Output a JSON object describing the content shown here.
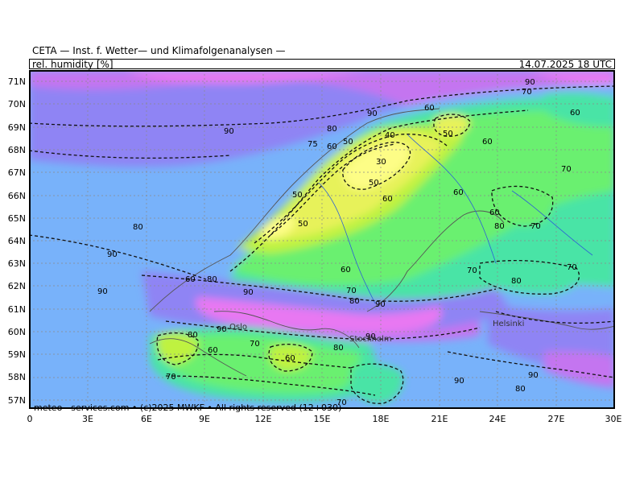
{
  "header": {
    "title": "CETA — Inst. f. Wetter— und Klimafolgenanalysen —",
    "variable": "rel. humidity [%]",
    "datetime": "14.07.2025 18 UTC"
  },
  "footer": "meteo—services.com • (c)2025 MWKF • All rights reserved (12+030)",
  "map": {
    "lat_labels": [
      "71N",
      "70N",
      "69N",
      "68N",
      "67N",
      "66N",
      "65N",
      "64N",
      "63N",
      "62N",
      "61N",
      "60N",
      "59N",
      "58N",
      "57N"
    ],
    "lon_labels": [
      "0",
      "3E",
      "6E",
      "9E",
      "12E",
      "15E",
      "18E",
      "21E",
      "24E",
      "27E",
      "30E"
    ],
    "city_labels": [
      "Oslo",
      "Stockholm",
      "Helsinki"
    ],
    "contour_labels": [
      "90",
      "60",
      "90",
      "70",
      "60",
      "80",
      "60",
      "50",
      "40",
      "90",
      "75",
      "60",
      "50",
      "30",
      "70",
      "50",
      "60",
      "60",
      "50",
      "60",
      "80",
      "70",
      "50",
      "80",
      "90",
      "60",
      "70",
      "70",
      "80",
      "90",
      "80",
      "90",
      "80",
      "90",
      "70",
      "60",
      "90",
      "90",
      "60",
      "80",
      "70",
      "80",
      "60",
      "70",
      "90",
      "80",
      "90",
      "70"
    ],
    "colors": {
      "h30": "#fdfd86",
      "h40": "#e7f25a",
      "h50": "#bff240",
      "h60": "#6af070",
      "h70": "#48e4a6",
      "h80": "#78b2fa",
      "h90": "#8f84f4",
      "h95": "#c474f0",
      "h100": "#e878f2"
    }
  }
}
